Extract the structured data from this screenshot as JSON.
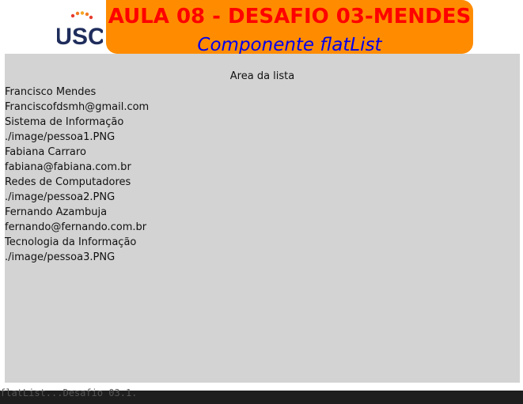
{
  "header": {
    "logo_text": "USC",
    "title": "AULA 08 - DESAFIO 03-MENDES",
    "subtitle": "Componente flatList"
  },
  "list": {
    "header": "Area da lista",
    "items": [
      {
        "name": "Francisco Mendes",
        "email": "Franciscofdsmh@gmail.com",
        "course": "Sistema de Informação",
        "image": "./image/pessoa1.PNG"
      },
      {
        "name": "Fabiana Carraro",
        "email": "fabiana@fabiana.com.br",
        "course": "Redes de Computadores",
        "image": "./image/pessoa2.PNG"
      },
      {
        "name": "Fernando Azambuja",
        "email": "fernando@fernando.com.br",
        "course": "Tecnologia da Informação",
        "image": "./image/pessoa3.PNG"
      }
    ]
  },
  "footer": {
    "text": "flatList...Desafio 03.1."
  },
  "colors": {
    "banner": "#ff8c00",
    "title": "#ff0000",
    "subtitle": "#0000ee",
    "list_bg": "#d3d3d3"
  }
}
